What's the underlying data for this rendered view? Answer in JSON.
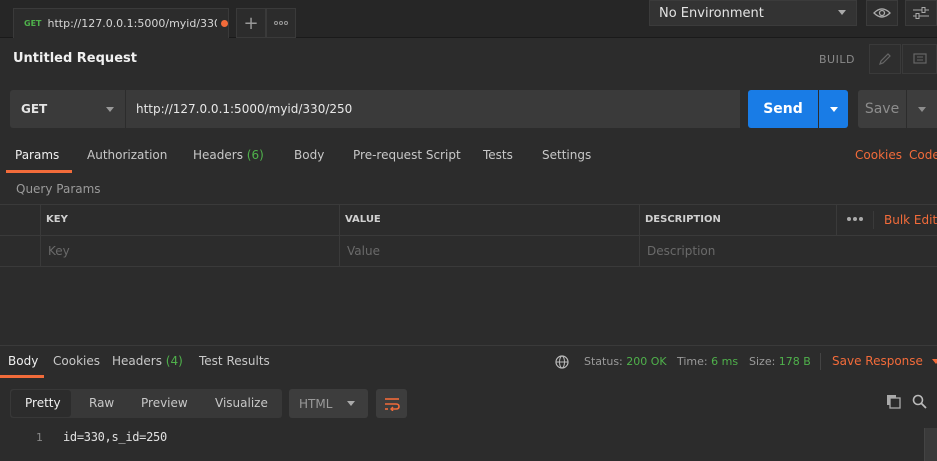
{
  "tab": {
    "method": "GET",
    "title": "http://127.0.0.1:5000/myid/330..."
  },
  "environment": {
    "selected": "No Environment"
  },
  "request": {
    "title": "Untitled Request",
    "build_label": "BUILD",
    "method": "GET",
    "url": "http://127.0.0.1:5000/myid/330/250",
    "send_label": "Send",
    "save_label": "Save"
  },
  "request_tabs": {
    "params": "Params",
    "authorization": "Authorization",
    "headers": "Headers",
    "headers_count": "(6)",
    "body": "Body",
    "pre_request": "Pre-request Script",
    "tests": "Tests",
    "settings": "Settings",
    "cookies": "Cookies",
    "code": "Code"
  },
  "query_params": {
    "label": "Query Params",
    "columns": {
      "key": "KEY",
      "value": "VALUE",
      "description": "DESCRIPTION"
    },
    "bulk_edit": "Bulk Edit",
    "placeholders": {
      "key": "Key",
      "value": "Value",
      "description": "Description"
    }
  },
  "response_tabs": {
    "body": "Body",
    "cookies": "Cookies",
    "headers": "Headers",
    "headers_count": "(4)",
    "test_results": "Test Results"
  },
  "status": {
    "status_label": "Status:",
    "status_value": "200 OK",
    "time_label": "Time:",
    "time_value": "6 ms",
    "size_label": "Size:",
    "size_value": "178 B",
    "save_response": "Save Response"
  },
  "view_modes": [
    "Pretty",
    "Raw",
    "Preview",
    "Visualize"
  ],
  "format": "HTML",
  "response_body": {
    "line_number": "1",
    "content": "id=330,s_id=250"
  },
  "colors": {
    "accent": "#f26b3a",
    "send": "#197ce6",
    "success": "#4fb14b",
    "background": "#2c2c2c"
  }
}
